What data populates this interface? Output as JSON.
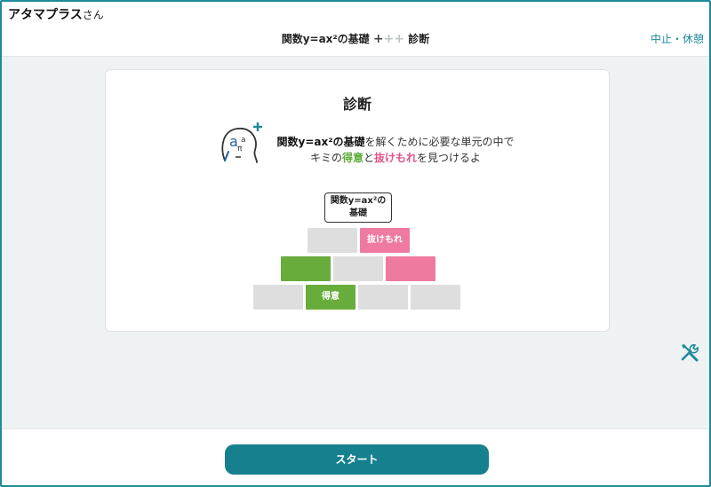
{
  "header": {
    "user_name": "アタマプラス",
    "user_suffix": "さん",
    "lesson_title": "関数y=ax²の基礎",
    "lesson_mark_active": "+",
    "lesson_mark_inactive": "++",
    "lesson_mode": "診断",
    "pause_label": "中止・休憩"
  },
  "card": {
    "title": "診断",
    "description_line1_bold": "関数y=ax²の基礎",
    "description_line1_rest": "を解くために必要な単元の中で",
    "description_line2_a": "キミの",
    "description_line2_strength": "得意",
    "description_line2_b": "と",
    "description_line2_weakness": "抜けもれ",
    "description_line2_c": "を見つけるよ",
    "pyramid_goal_line1": "関数y=ax²の",
    "pyramid_goal_line2": "基礎",
    "block_weakness_label": "抜けもれ",
    "block_strength_label": "得意"
  },
  "character": {
    "letter_big": "a",
    "letter_small": "a",
    "symbol": "π"
  },
  "footer": {
    "start_label": "スタート"
  },
  "colors": {
    "accent": "#1f8a99",
    "button": "#17808f",
    "strength": "#68ad3c",
    "weakness": "#ee7aa0"
  },
  "icons": {
    "tools": "tools-icon",
    "character": "atama-character-icon"
  }
}
